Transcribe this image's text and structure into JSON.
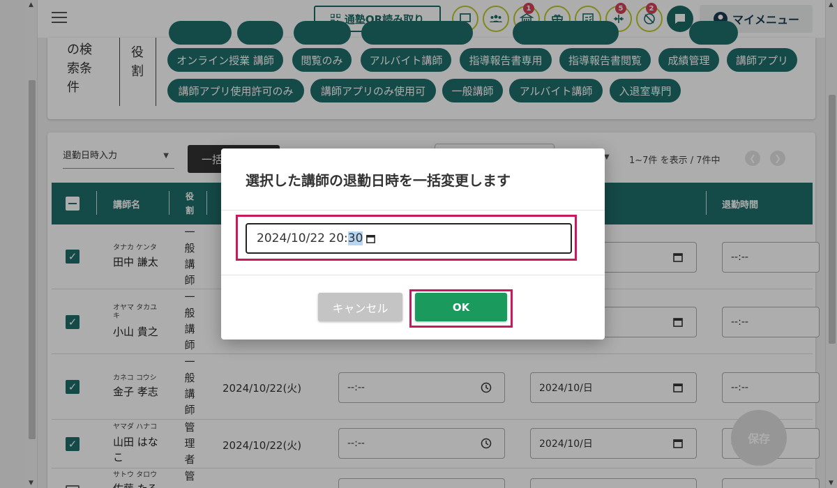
{
  "header": {
    "qr_button": "通塾QR読み取り",
    "icons": [
      {
        "name": "chat-icon",
        "badge": ""
      },
      {
        "name": "group-icon",
        "badge": ""
      },
      {
        "name": "school-icon",
        "badge": "1"
      },
      {
        "name": "gift-icon",
        "badge": ""
      },
      {
        "name": "report-icon",
        "badge": ""
      },
      {
        "name": "shrink-icon",
        "badge": "5"
      },
      {
        "name": "no-entry-icon",
        "badge": "2"
      }
    ],
    "my_menu": "マイメニュー"
  },
  "search": {
    "label_lines": [
      "の検",
      "索条",
      "件"
    ],
    "role_label_lines": [
      "役",
      "割"
    ],
    "chips_row1": [
      "オンライン授業 講師",
      "閲覧のみ",
      "アルバイト講師",
      "指導報告書専用",
      "指導報告書閲覧",
      "成績管理",
      "講師アプリ"
    ],
    "chips_row2": [
      "講師アプリ使用許可のみ",
      "講師アプリのみ使用可",
      "一般講師",
      "アルバイト講師",
      "入退室専門"
    ]
  },
  "toolbar": {
    "select_label": "退勤日時入力",
    "bulk_button": "一括",
    "count_text": "1~7件 を表示 / 7件中"
  },
  "table": {
    "headers": {
      "name": "講師名",
      "role": "役割",
      "leave_time": "退勤時間"
    },
    "rows": [
      {
        "kana": "タナカ ケンタ",
        "name": "田中 謙太",
        "role": [
          "一",
          "般",
          "講",
          "師"
        ],
        "checked": true,
        "date": "",
        "time": "",
        "date2": "",
        "time2": "--:--"
      },
      {
        "kana": "オヤマ タカユキ",
        "name": "小山 貴之",
        "role": [
          "一",
          "般",
          "講",
          "師"
        ],
        "checked": true,
        "date": "",
        "time": "",
        "date2": "",
        "time2": "--:--"
      },
      {
        "kana": "カネコ コウシ",
        "name": "金子 孝志",
        "role": [
          "一",
          "般",
          "講",
          "師"
        ],
        "checked": true,
        "date": "2024/10/22(火)",
        "time": "--:--",
        "date2": "2024/10/日",
        "time2": "--:--"
      },
      {
        "kana": "ヤマダ ハナコ",
        "name": "山田 はなこ",
        "role": [
          "管",
          "理",
          "者"
        ],
        "checked": true,
        "date": "2024/10/22(火)",
        "time": "--:--",
        "date2": "2024/10/日",
        "time2": "--:--"
      },
      {
        "kana": "サトウ タロウ",
        "name": "佐藤 たろ",
        "role": [
          "管"
        ],
        "checked": false,
        "date": "",
        "time": "--:--",
        "date2": "",
        "time2": ""
      }
    ]
  },
  "save_fab": "保存",
  "modal": {
    "title": "選択した講師の退勤日時を一括変更します",
    "datetime_before": "2024/10/22 20:",
    "datetime_selected": "30",
    "cancel": "キャンセル",
    "ok": "OK"
  },
  "colors": {
    "primary": "#1e6e6a",
    "ok_green": "#1b9a5e",
    "highlight": "#c8185e",
    "badge": "#d6425b",
    "icon_ring": "#bdc92a"
  }
}
